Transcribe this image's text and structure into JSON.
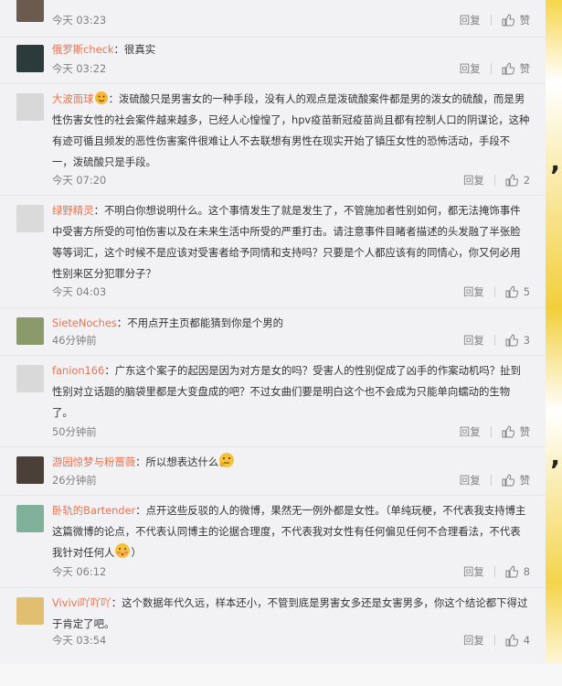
{
  "comments": [
    {
      "user": "",
      "text": "",
      "time": "今天 03:23",
      "reply": "回复",
      "likes": "赞"
    },
    {
      "user": "俄罗斯check",
      "text": "：很真实",
      "time": "今天 03:22",
      "reply": "回复",
      "likes": "赞"
    },
    {
      "user": "大波面球",
      "text": "：泼硫酸只是男害女的一种手段，没有人的观点是泼硫酸案件都是男的泼女的硫酸，而是男性伤害女性的社会案件越来越多，已经人心惶惶了，hpv疫苗新冠疫苗尚且都有控制人口的阴谋论，这种有迹可循且频发的恶性伤害案件很难让人不去联想有男性在现实开始了镇压女性的恐怖活动，手段不一，泼硫酸只是手段。",
      "time": "今天 07:20",
      "reply": "回复",
      "likes": "2"
    },
    {
      "user": "绿野精灵",
      "text": "：不明白你想说明什么。这个事情发生了就是发生了，不管施加者性别如何，都无法掩饰事件中受害方所受的可怕伤害以及在未来生活中所受的严重打击。请注意事件目睹者描述的头发融了半张脸等等词汇，这个时候不是应该对受害者给予同情和支持吗？只要是个人都应该有的同情心，你又何必用性别来区分犯罪分子？",
      "time": "今天 04:03",
      "reply": "回复",
      "likes": "5"
    },
    {
      "user": "SieteNoches",
      "text": "：不用点开主页都能猜到你是个男的",
      "time": "46分钟前",
      "reply": "回复",
      "likes": "3"
    },
    {
      "user": "fanion166",
      "text": "：广东这个案子的起因是因为对方是女的吗？受害人的性别促成了凶手的作案动机吗？扯到性别对立话题的脑袋里都是大变盘成的吧？不过女曲们要是明白这个也不会成为只能单向蠕动的生物了。",
      "time": "50分钟前",
      "reply": "回复",
      "likes": "赞"
    },
    {
      "user": "游园惊梦与粉蔷薇",
      "text": "：所以想表达什么",
      "time": "26分钟前",
      "reply": "回复",
      "likes": "赞"
    },
    {
      "user": "卧轨的Bartender",
      "text": "：点开这些反驳的人的微博，果然无一例外都是女性。（单纯玩梗，不代表我支持博主这篇微博的论点，不代表认同博主的论据合理度，不代表我对女性有任何偏见任何不合理看法，不代表我针对任何人",
      "text_tail": "）",
      "time": "今天 06:12",
      "reply": "回复",
      "likes": "8"
    },
    {
      "user": "Vivivi吖吖吖",
      "text": "：这个数据年代久远，样本还小，不管到底是男害女多还是女害男多，你这个结论都下得过于肯定了吧。",
      "time": "今天 03:54",
      "reply": "回复",
      "likes": "4"
    }
  ],
  "avatars": [
    "#6b5b4f",
    "#2b3a3a",
    "#d8d8d8",
    "#dadada",
    "#8a9a6a",
    "#d9d9d9",
    "#4a4038",
    "#7fb09a",
    "#e0c070"
  ],
  "emoji_names": [
    "smirk-emoji",
    "thinking-emoji",
    "shy-emoji"
  ]
}
